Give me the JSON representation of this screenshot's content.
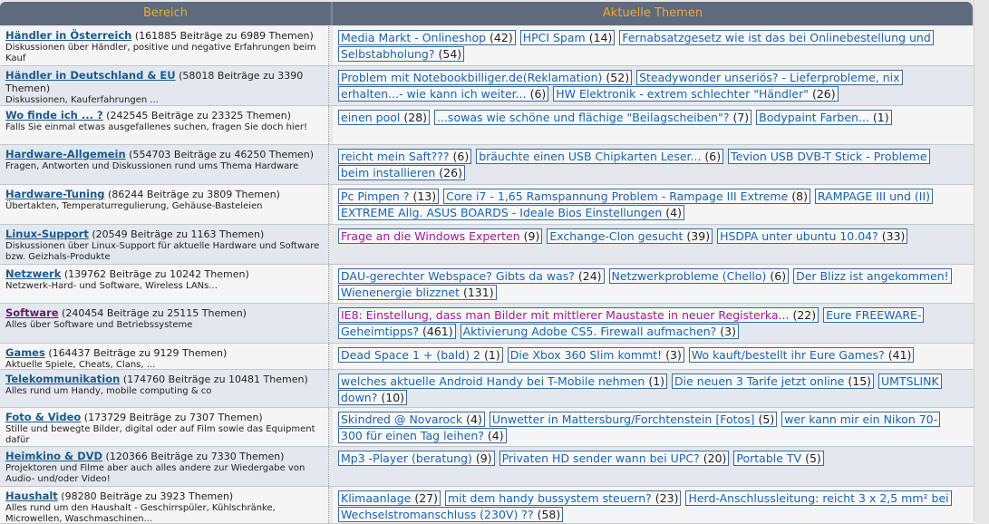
{
  "header": {
    "left": "Bereich",
    "right": "Aktuelle Themen"
  },
  "rows": [
    {
      "name": "Händler in Österreich",
      "stats": " (161885 Beiträge zu 6989 Themen)",
      "desc": "Diskussionen über Händler, positive und negative Erfahrungen beim Kauf",
      "topics": [
        {
          "title": "Media Markt - Onlineshop",
          "count": "(42)"
        },
        {
          "title": "HPCI Spam",
          "count": "(14)"
        },
        {
          "title": "Fernabsatzgesetz wie ist das bei Onlinebestellung und Selbstabholung?",
          "count": "(54)"
        }
      ]
    },
    {
      "name": "Händler in Deutschland & EU",
      "stats": " (58018 Beiträge zu 3390 Themen)",
      "desc": "Diskussionen, Kauferfahrungen ...",
      "topics": [
        {
          "title": "Problem mit Notebookbilliger.de(Reklamation)",
          "count": "(52)"
        },
        {
          "title": "Steadywonder unseriös? - Lieferprobleme, nix erhalten...- wie kann ich weiter...",
          "count": "(6)"
        },
        {
          "title": "HW Elektronik - extrem schlechter \"Händler\"",
          "count": "(26)"
        }
      ]
    },
    {
      "name": "Wo finde ich ... ?",
      "stats": " (242545 Beiträge zu 23325 Themen)",
      "desc": "Falls Sie einmal etwas ausgefallenes suchen, fragen Sie doch hier!",
      "topics": [
        {
          "title": "einen pool",
          "count": "(28)"
        },
        {
          "title": "...sowas wie schöne und flächige \"Beilagscheiben\"?",
          "count": "(7)"
        },
        {
          "title": "Bodypaint Farben...",
          "count": "(1)"
        }
      ]
    },
    {
      "name": "Hardware-Allgemein",
      "stats": " (554703 Beiträge zu 46250 Themen)",
      "desc": "Fragen, Antworten und Diskussionen rund ums Thema Hardware",
      "topics": [
        {
          "title": "reicht mein Saft???",
          "count": "(6)"
        },
        {
          "title": "bräuchte einen USB Chipkarten Leser...",
          "count": "(6)"
        },
        {
          "title": "Tevion USB DVB-T Stick - Probleme beim installieren",
          "count": "(26)"
        }
      ]
    },
    {
      "name": "Hardware-Tuning",
      "stats": " (86244 Beiträge zu 3809 Themen)",
      "desc": "Übertakten, Temperaturregulierung, Gehäuse-Basteleien",
      "topics": [
        {
          "title": "Pc Pimpen ?",
          "count": "(13)"
        },
        {
          "title": "Core i7 - 1,65 Ramspannung Problem - Rampage III Extreme",
          "count": "(8)"
        },
        {
          "title": "RAMPAGE III und (II) EXTREME Allg. ASUS BOARDS - Ideale Bios Einstellungen",
          "count": "(4)"
        }
      ]
    },
    {
      "name": "Linux-Support",
      "stats": " (20549 Beiträge zu 1163 Themen)",
      "desc": "Diskussionen über Linux-Support für aktuelle Hardware und Software bzw. Geizhals-Produkte",
      "topics": [
        {
          "title": "Frage an die Windows Experten",
          "count": "(9)",
          "visited": true
        },
        {
          "title": "Exchange-Clon gesucht",
          "count": "(39)"
        },
        {
          "title": "HSDPA unter ubuntu 10.04?",
          "count": "(33)"
        }
      ]
    },
    {
      "name": "Netzwerk",
      "stats": " (139762 Beiträge zu 10242 Themen)",
      "desc": "Netzwerk-Hard- und Software, Wireless LANs...",
      "topics": [
        {
          "title": "DAU-gerechter Webspace? Gibts da was?",
          "count": "(24)"
        },
        {
          "title": "Netzwerkprobleme (Chello)",
          "count": "(6)"
        },
        {
          "title": "Der Blizz ist angekommen! Wienenergie blizznet",
          "count": "(131)"
        }
      ]
    },
    {
      "name": "Software",
      "stats": " (240454 Beiträge zu 25115 Themen)",
      "visited": true,
      "desc": "Alles über Software und Betriebssysteme",
      "topics": [
        {
          "title": "IE8: Einstellung, dass man Bilder mit mittlerer Maustaste in neuer Registerka...",
          "count": "(22)",
          "visited": true
        },
        {
          "title": "Eure FREEWARE-Geheimtipps?",
          "count": "(461)"
        },
        {
          "title": "Aktivierung Adobe CS5. Firewall aufmachen?",
          "count": "(3)"
        }
      ]
    },
    {
      "name": "Games",
      "stats": " (164437 Beiträge zu 9129 Themen)",
      "desc": "Aktuelle Spiele, Cheats, Clans, ...",
      "topics": [
        {
          "title": "Dead Space 1 + (bald) 2",
          "count": "(1)"
        },
        {
          "title": "Die Xbox 360 Slim kommt!",
          "count": "(3)"
        },
        {
          "title": "Wo kauft/bestellt ihr Eure Games?",
          "count": "(41)"
        }
      ]
    },
    {
      "name": "Telekommunikation",
      "stats": " (174760 Beiträge zu 10481 Themen)",
      "desc": "Alles rund um Handy, mobile computing & co",
      "topics": [
        {
          "title": "welches aktuelle Android Handy bei T-Mobile nehmen",
          "count": "(1)"
        },
        {
          "title": "Die neuen 3 Tarife jetzt online",
          "count": "(15)"
        },
        {
          "title": "UMTSLINK down?",
          "count": "(10)"
        }
      ]
    },
    {
      "name": "Foto & Video",
      "stats": " (173729 Beiträge zu 7307 Themen)",
      "desc": "Stille und bewegte Bilder, digital oder auf Film sowie das Equipment dafür",
      "topics": [
        {
          "title": "Skindred @ Novarock",
          "count": "(4)"
        },
        {
          "title": "Unwetter in Mattersburg/Forchtenstein [Fotos]",
          "count": "(5)"
        },
        {
          "title": "wer kann mir ein Nikon 70-300 für einen Tag leihen?",
          "count": "(4)"
        }
      ]
    },
    {
      "name": "Heimkino & DVD",
      "stats": " (120366 Beiträge zu 7330 Themen)",
      "desc": "Projektoren und Filme aber auch alles andere zur Wiedergabe von Audio- und/oder Video!",
      "topics": [
        {
          "title": "Mp3 -Player (beratung)",
          "count": "(9)"
        },
        {
          "title": "Privaten HD sender wann bei UPC?",
          "count": "(20)"
        },
        {
          "title": "Portable TV",
          "count": "(5)"
        }
      ]
    },
    {
      "name": "Haushalt",
      "stats": " (98280 Beiträge zu 3923 Themen)",
      "desc": "Alles rund um den Haushalt - Geschirrspüler, Kühlschränke, Microwellen, Waschmaschinen...",
      "topics": [
        {
          "title": "Klimaanlage",
          "count": "(27)"
        },
        {
          "title": "mit dem handy bussystem steuern?",
          "count": "(23)"
        },
        {
          "title": "Herd-Anschlussleitung: reicht 3 x 2,5 mm² bei Wechselstromanschluss (230V) ??",
          "count": "(58)"
        }
      ]
    }
  ]
}
